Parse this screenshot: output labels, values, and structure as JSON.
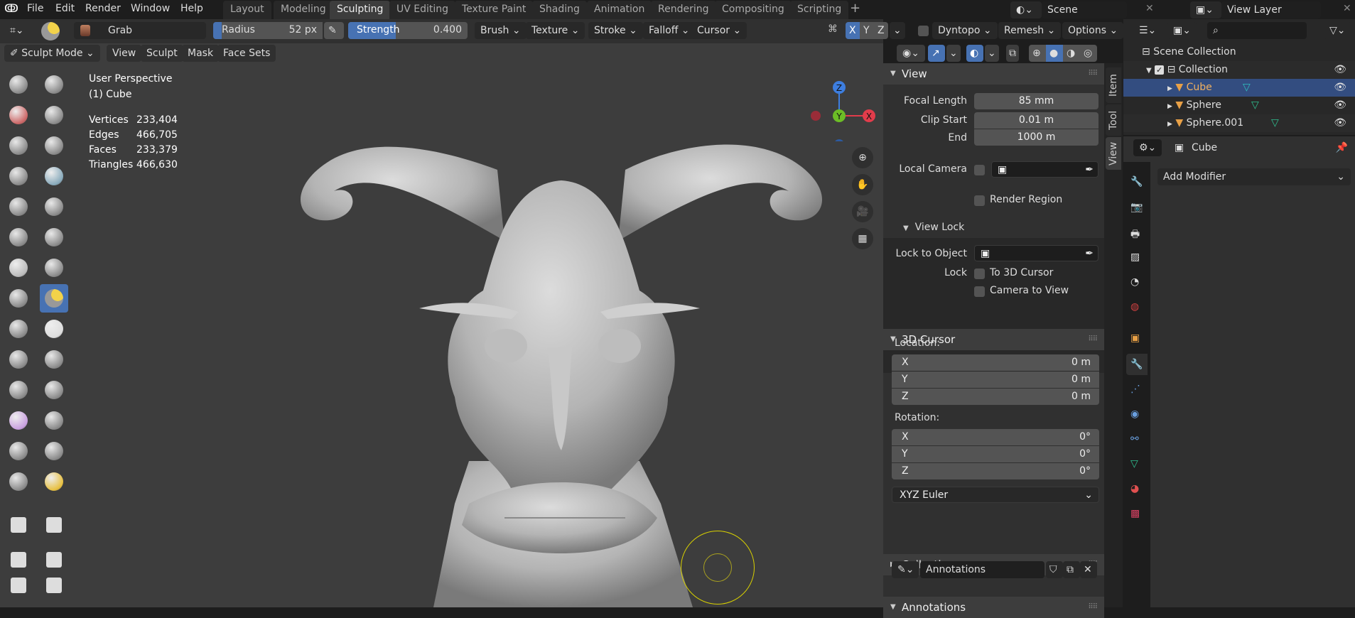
{
  "menu": {
    "items": [
      "File",
      "Edit",
      "Render",
      "Window",
      "Help"
    ]
  },
  "workspaces": {
    "tabs": [
      "Layout",
      "Modeling",
      "Sculpting",
      "UV Editing",
      "Texture Paint",
      "Shading",
      "Animation",
      "Rendering",
      "Compositing",
      "Scripting"
    ],
    "active": "Sculpting",
    "add": "+"
  },
  "scene": {
    "name": "Scene",
    "view_layer": "View Layer"
  },
  "tool_header": {
    "brush_name": "Grab",
    "radius_label": "Radius",
    "radius_value": "52 px",
    "strength_label": "Strength",
    "strength_value": "0.400",
    "strength_fraction": 0.4,
    "menus": [
      "Brush",
      "Texture",
      "Stroke",
      "Falloff",
      "Cursor"
    ],
    "axes": [
      "X",
      "Y",
      "Z"
    ],
    "dyntopo": "Dyntopo",
    "remesh": "Remesh",
    "options": "Options"
  },
  "mode_header": {
    "mode": "Sculpt Mode",
    "menus": [
      "View",
      "Sculpt",
      "Mask",
      "Face Sets"
    ]
  },
  "viewport": {
    "perspective": "User Perspective",
    "object": "(1) Cube",
    "stats": [
      {
        "label": "Vertices",
        "value": "233,404"
      },
      {
        "label": "Edges",
        "value": "466,705"
      },
      {
        "label": "Faces",
        "value": "233,379"
      },
      {
        "label": "Triangles",
        "value": "466,630"
      }
    ],
    "gizmo": {
      "x": "X",
      "y": "Y",
      "z": "Z"
    }
  },
  "toolbar": {
    "tools": [
      "draw",
      "draw-sharp",
      "clay",
      "clay-strips",
      "clay-thumb",
      "layer",
      "inflate",
      "blob",
      "crease",
      "smooth",
      "flatten",
      "fill",
      "scrape",
      "multiplane-scrape",
      "pinch",
      "grab",
      "elastic-deform",
      "snake-hook",
      "thumb",
      "pose",
      "nudge",
      "rotate",
      "slide-relax",
      "boundary",
      "cloth",
      "simplify",
      "mask",
      "draw-face-sets",
      "box-mask",
      "box-hide",
      "mesh-filter",
      "cloth-filter",
      "transform",
      "rotate-tool"
    ],
    "active": "grab"
  },
  "npanel": {
    "tabs": [
      "Item",
      "Tool",
      "View"
    ],
    "active_tab": "View",
    "view": {
      "title": "View",
      "focal_length_label": "Focal Length",
      "focal_length": "85 mm",
      "clip_start_label": "Clip Start",
      "clip_start": "0.01 m",
      "end_label": "End",
      "end": "1000 m",
      "local_camera_label": "Local Camera",
      "render_region_label": "Render Region"
    },
    "view_lock": {
      "title": "View Lock",
      "lock_to_object_label": "Lock to Object",
      "lock_label": "Lock",
      "to_3d_cursor": "To 3D Cursor",
      "camera_to_view": "Camera to View"
    },
    "cursor": {
      "title": "3D Cursor",
      "location_label": "Location:",
      "location": [
        {
          "axis": "X",
          "value": "0 m"
        },
        {
          "axis": "Y",
          "value": "0 m"
        },
        {
          "axis": "Z",
          "value": "0 m"
        }
      ],
      "rotation_label": "Rotation:",
      "rotation": [
        {
          "axis": "X",
          "value": "0°"
        },
        {
          "axis": "Y",
          "value": "0°"
        },
        {
          "axis": "Z",
          "value": "0°"
        }
      ],
      "rotation_mode": "XYZ Euler"
    },
    "collections": {
      "title": "Collections"
    },
    "annotations": {
      "title": "Annotations",
      "name": "Annotations"
    }
  },
  "outliner": {
    "scene_collection": "Scene Collection",
    "collection": "Collection",
    "objects": [
      {
        "name": "Cube",
        "selected": true
      },
      {
        "name": "Sphere",
        "selected": false
      },
      {
        "name": "Sphere.001",
        "selected": false
      }
    ]
  },
  "properties": {
    "object": "Cube",
    "add_modifier": "Add Modifier"
  },
  "colors": {
    "accent": "#4772b3",
    "viewport": "#3d3d3d",
    "object_orange": "#e8a046",
    "mesh_green": "#2fbf8f",
    "x_axis": "#e23c4b",
    "y_axis": "#6cbd26",
    "z_axis": "#3d7ee0"
  }
}
